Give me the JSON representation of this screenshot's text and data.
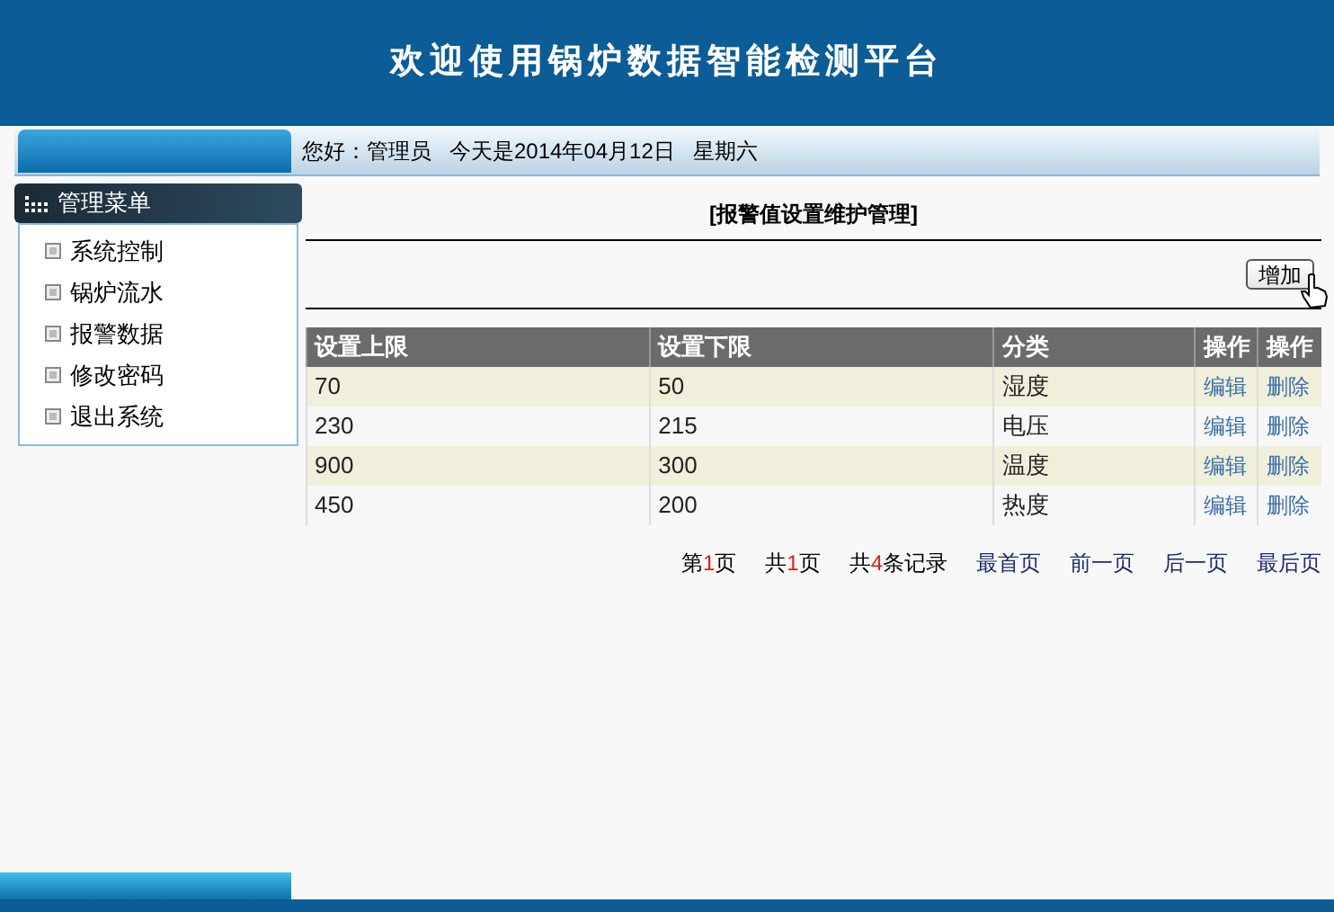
{
  "header": {
    "title": "欢迎使用锅炉数据智能检测平台"
  },
  "info_bar": {
    "greeting": "您好：管理员",
    "date": "今天是2014年04月12日",
    "weekday": "星期六"
  },
  "sidebar": {
    "title": "管理菜单",
    "items": [
      {
        "label": "系统控制"
      },
      {
        "label": "锅炉流水"
      },
      {
        "label": "报警数据"
      },
      {
        "label": "修改密码"
      },
      {
        "label": "退出系统"
      }
    ]
  },
  "page_title": "[报警值设置维护管理]",
  "add_button": "增加",
  "table": {
    "columns": [
      "设置上限",
      "设置下限",
      "分类",
      "操作",
      "操作"
    ],
    "rows": [
      [
        "70",
        "50",
        "湿度",
        "编辑",
        "删除"
      ],
      [
        "230",
        "215",
        "电压",
        "编辑",
        "删除"
      ],
      [
        "900",
        "300",
        "温度",
        "编辑",
        "删除"
      ],
      [
        "450",
        "200",
        "热度",
        "编辑",
        "删除"
      ]
    ]
  },
  "pagination": [
    {
      "kind": "count",
      "prefix": "第",
      "number": "1",
      "suffix": "页"
    },
    {
      "kind": "count",
      "prefix": "共",
      "number": "1",
      "suffix": "页"
    },
    {
      "kind": "count",
      "prefix": "共",
      "number": "4",
      "suffix": "条记录"
    },
    {
      "kind": "link",
      "label": "最首页"
    },
    {
      "kind": "link",
      "label": "前一页"
    },
    {
      "kind": "link",
      "label": "后一页"
    },
    {
      "kind": "link",
      "label": "最后页"
    }
  ]
}
